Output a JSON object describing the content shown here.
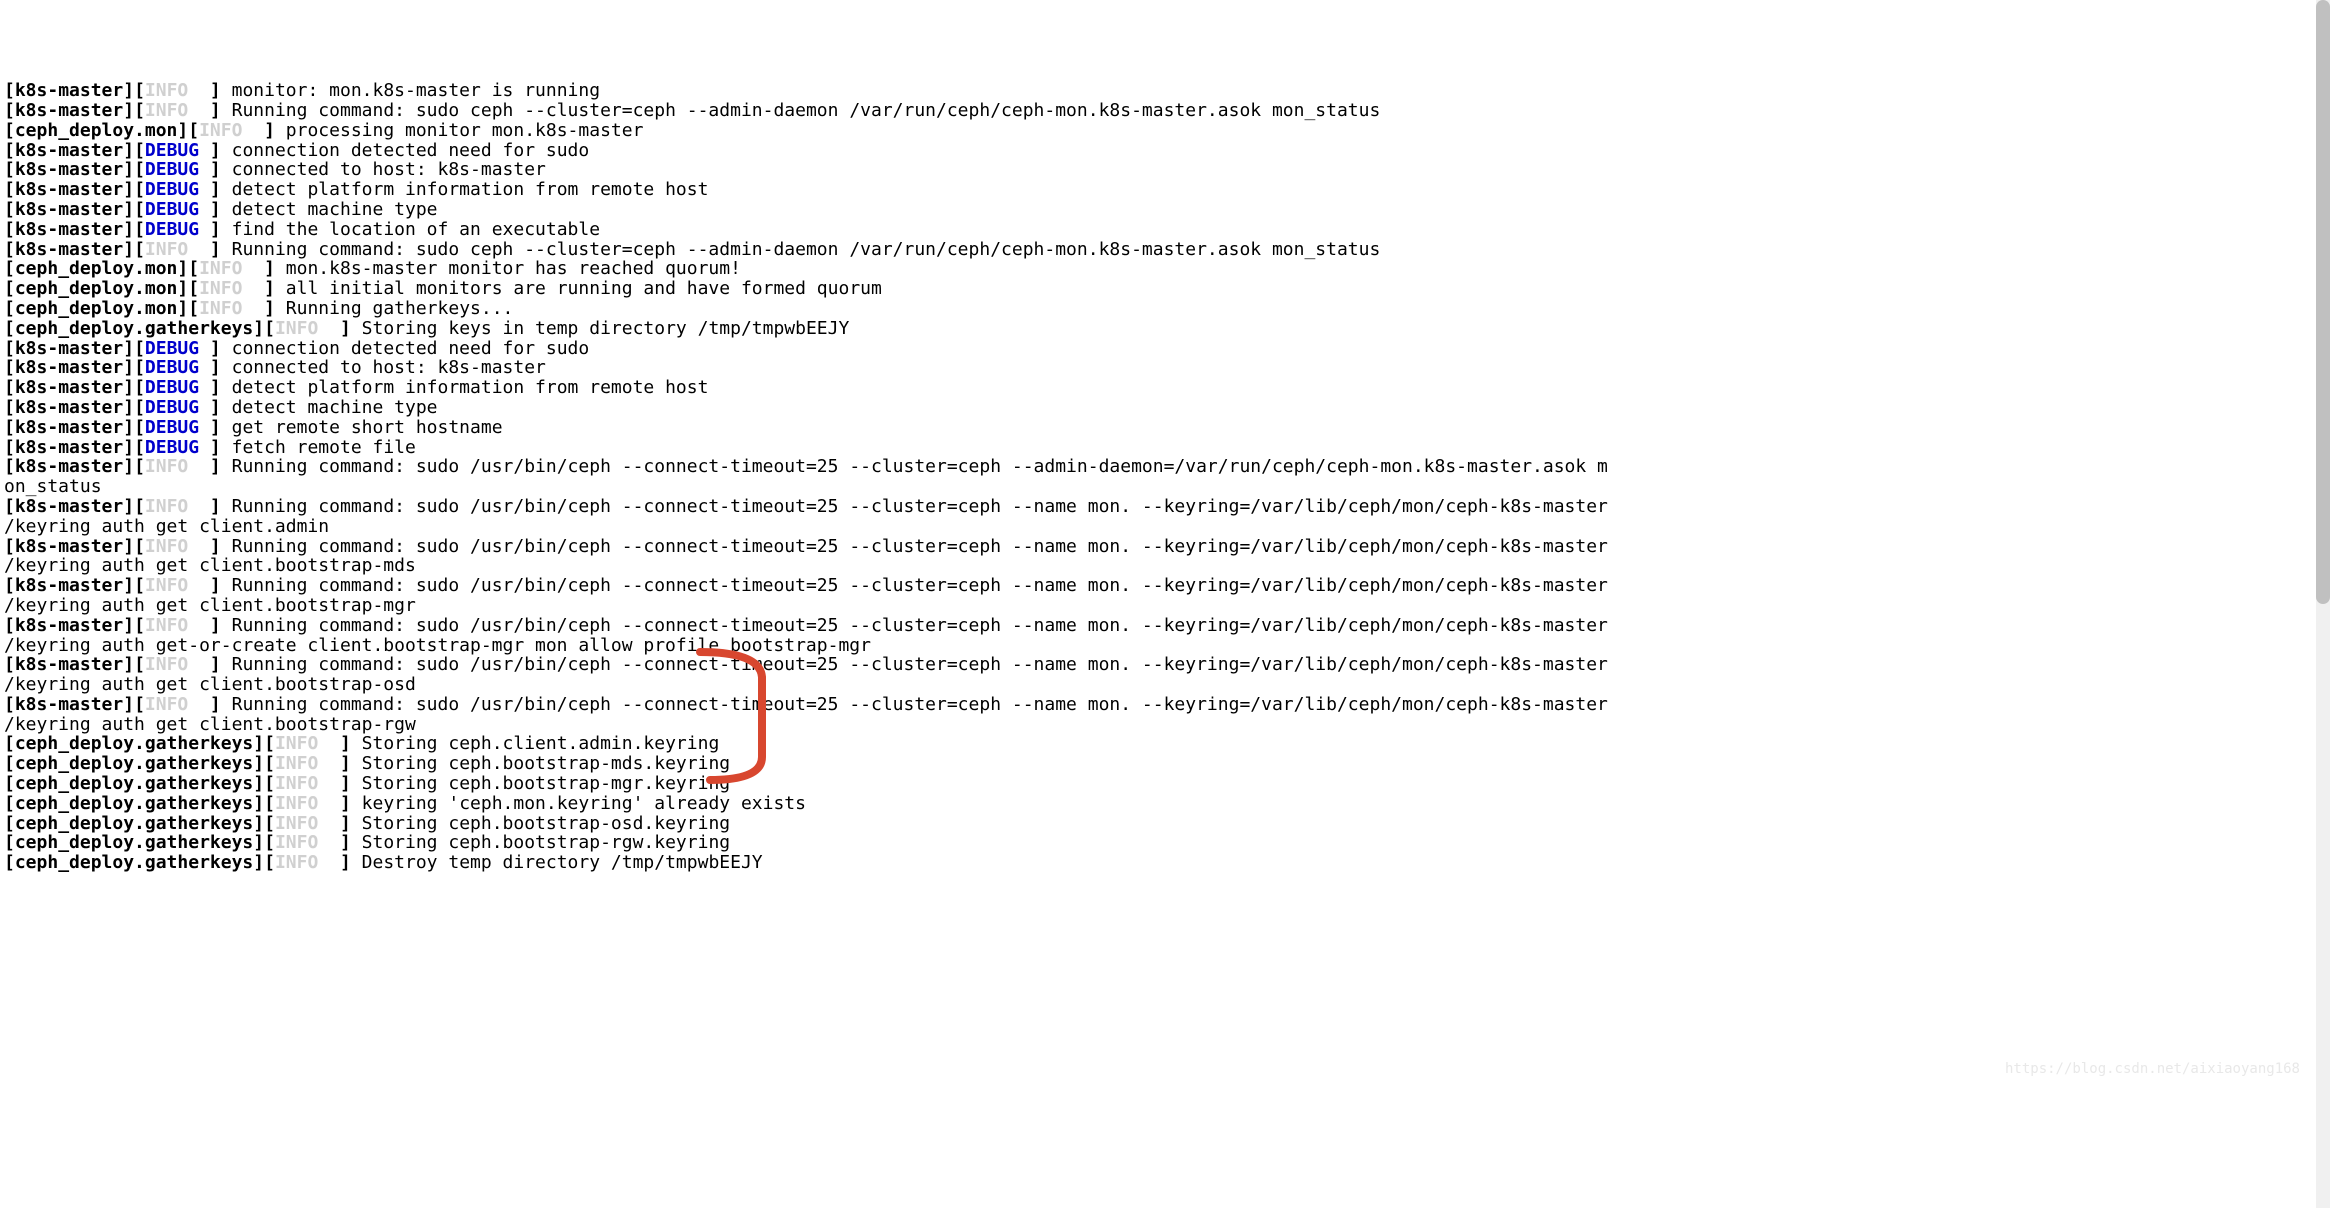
{
  "lines": [
    {
      "source": "k8s-master",
      "level": "INFO",
      "msg": "monitor: mon.k8s-master is running"
    },
    {
      "source": "k8s-master",
      "level": "INFO",
      "msg": "Running command: sudo ceph --cluster=ceph --admin-daemon /var/run/ceph/ceph-mon.k8s-master.asok mon_status"
    },
    {
      "source": "ceph_deploy.mon",
      "level": "INFO",
      "msg": "processing monitor mon.k8s-master"
    },
    {
      "source": "k8s-master",
      "level": "DEBUG",
      "msg": "connection detected need for sudo"
    },
    {
      "source": "k8s-master",
      "level": "DEBUG",
      "msg": "connected to host: k8s-master"
    },
    {
      "source": "k8s-master",
      "level": "DEBUG",
      "msg": "detect platform information from remote host"
    },
    {
      "source": "k8s-master",
      "level": "DEBUG",
      "msg": "detect machine type"
    },
    {
      "source": "k8s-master",
      "level": "DEBUG",
      "msg": "find the location of an executable"
    },
    {
      "source": "k8s-master",
      "level": "INFO",
      "msg": "Running command: sudo ceph --cluster=ceph --admin-daemon /var/run/ceph/ceph-mon.k8s-master.asok mon_status"
    },
    {
      "source": "ceph_deploy.mon",
      "level": "INFO",
      "msg": "mon.k8s-master monitor has reached quorum!"
    },
    {
      "source": "ceph_deploy.mon",
      "level": "INFO",
      "msg": "all initial monitors are running and have formed quorum"
    },
    {
      "source": "ceph_deploy.mon",
      "level": "INFO",
      "msg": "Running gatherkeys..."
    },
    {
      "source": "ceph_deploy.gatherkeys",
      "level": "INFO",
      "msg": "Storing keys in temp directory /tmp/tmpwbEEJY"
    },
    {
      "source": "k8s-master",
      "level": "DEBUG",
      "msg": "connection detected need for sudo"
    },
    {
      "source": "k8s-master",
      "level": "DEBUG",
      "msg": "connected to host: k8s-master"
    },
    {
      "source": "k8s-master",
      "level": "DEBUG",
      "msg": "detect platform information from remote host"
    },
    {
      "source": "k8s-master",
      "level": "DEBUG",
      "msg": "detect machine type"
    },
    {
      "source": "k8s-master",
      "level": "DEBUG",
      "msg": "get remote short hostname"
    },
    {
      "source": "k8s-master",
      "level": "DEBUG",
      "msg": "fetch remote file"
    },
    {
      "source": "k8s-master",
      "level": "INFO",
      "msg": "Running command: sudo /usr/bin/ceph --connect-timeout=25 --cluster=ceph --admin-daemon=/var/run/ceph/ceph-mon.k8s-master.asok m",
      "cont": "on_status"
    },
    {
      "source": "k8s-master",
      "level": "INFO",
      "msg": "Running command: sudo /usr/bin/ceph --connect-timeout=25 --cluster=ceph --name mon. --keyring=/var/lib/ceph/mon/ceph-k8s-master",
      "cont": "/keyring auth get client.admin"
    },
    {
      "source": "k8s-master",
      "level": "INFO",
      "msg": "Running command: sudo /usr/bin/ceph --connect-timeout=25 --cluster=ceph --name mon. --keyring=/var/lib/ceph/mon/ceph-k8s-master",
      "cont": "/keyring auth get client.bootstrap-mds"
    },
    {
      "source": "k8s-master",
      "level": "INFO",
      "msg": "Running command: sudo /usr/bin/ceph --connect-timeout=25 --cluster=ceph --name mon. --keyring=/var/lib/ceph/mon/ceph-k8s-master",
      "cont": "/keyring auth get client.bootstrap-mgr"
    },
    {
      "source": "k8s-master",
      "level": "INFO",
      "msg": "Running command: sudo /usr/bin/ceph --connect-timeout=25 --cluster=ceph --name mon. --keyring=/var/lib/ceph/mon/ceph-k8s-master",
      "cont": "/keyring auth get-or-create client.bootstrap-mgr mon allow profile bootstrap-mgr"
    },
    {
      "source": "k8s-master",
      "level": "INFO",
      "msg": "Running command: sudo /usr/bin/ceph --connect-timeout=25 --cluster=ceph --name mon. --keyring=/var/lib/ceph/mon/ceph-k8s-master",
      "cont": "/keyring auth get client.bootstrap-osd"
    },
    {
      "source": "k8s-master",
      "level": "INFO",
      "msg": "Running command: sudo /usr/bin/ceph --connect-timeout=25 --cluster=ceph --name mon. --keyring=/var/lib/ceph/mon/ceph-k8s-master",
      "cont": "/keyring auth get client.bootstrap-rgw"
    },
    {
      "source": "ceph_deploy.gatherkeys",
      "level": "INFO",
      "msg": "Storing ceph.client.admin.keyring"
    },
    {
      "source": "ceph_deploy.gatherkeys",
      "level": "INFO",
      "msg": "Storing ceph.bootstrap-mds.keyring"
    },
    {
      "source": "ceph_deploy.gatherkeys",
      "level": "INFO",
      "msg": "Storing ceph.bootstrap-mgr.keyring"
    },
    {
      "source": "ceph_deploy.gatherkeys",
      "level": "INFO",
      "msg": "keyring 'ceph.mon.keyring' already exists"
    },
    {
      "source": "ceph_deploy.gatherkeys",
      "level": "INFO",
      "msg": "Storing ceph.bootstrap-osd.keyring"
    },
    {
      "source": "ceph_deploy.gatherkeys",
      "level": "INFO",
      "msg": "Storing ceph.bootstrap-rgw.keyring"
    },
    {
      "source": "ceph_deploy.gatherkeys",
      "level": "INFO",
      "msg": "Destroy temp directory /tmp/tmpwbEEJY"
    }
  ],
  "watermark": "https://blog.csdn.net/aixiaoyang168",
  "annotation": {
    "color": "#d8472f",
    "stroke_width": 6
  }
}
